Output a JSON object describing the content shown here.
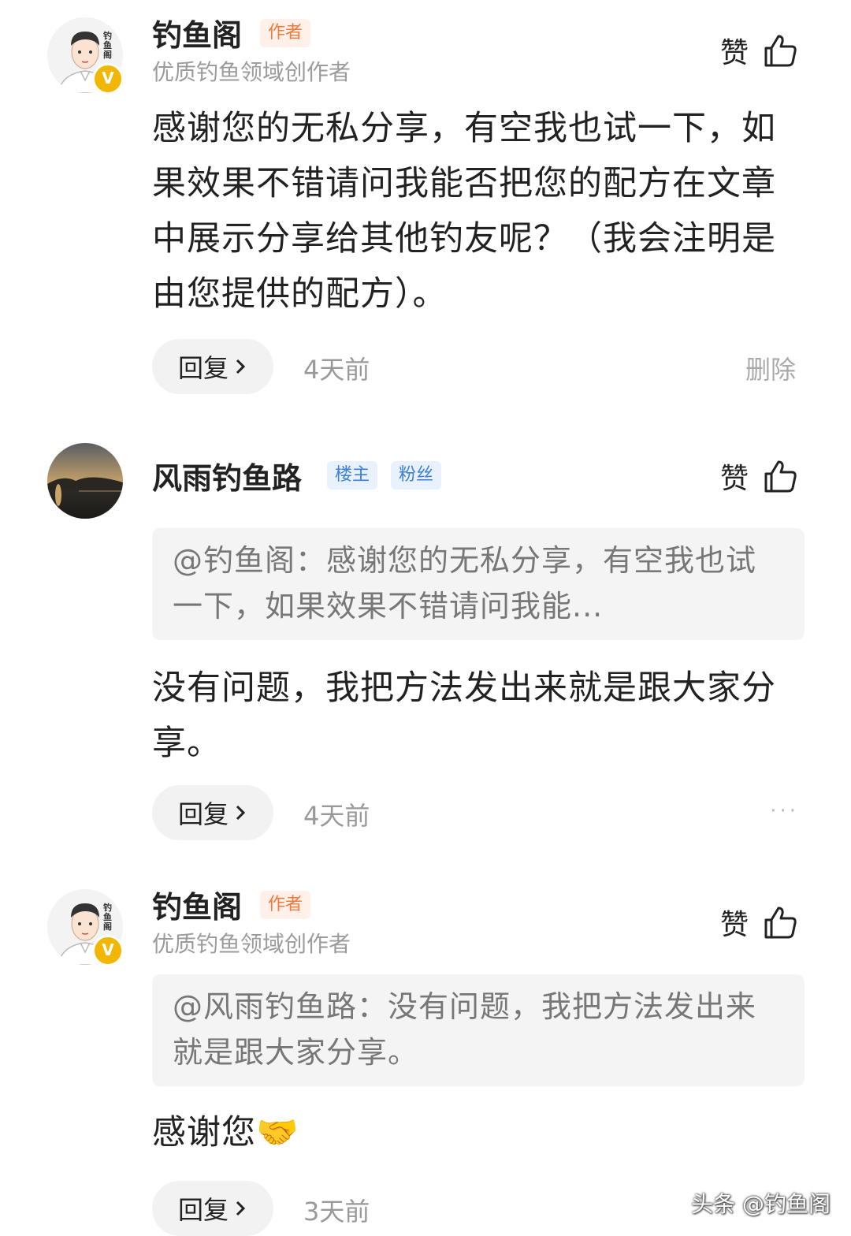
{
  "comments": [
    {
      "name": "钓鱼阁",
      "tag": "作者",
      "subtitle": "优质钓鱼领域创作者",
      "like_label": "赞",
      "text": "感谢您的无私分享，有空我也试一下，如果效果不错请问我能否把您的配方在文章中展示分享给其他钓友呢？（我会注明是由您提供的配方）。",
      "reply_label": "回复",
      "time": "4天前",
      "delete_label": "删除"
    },
    {
      "name": "风雨钓鱼路",
      "tags": [
        "楼主",
        "粉丝"
      ],
      "like_label": "赞",
      "quote": "@钓鱼阁：感谢您的无私分享，有空我也试一下，如果效果不错请问我能...",
      "text": "没有问题，我把方法发出来就是跟大家分享。",
      "reply_label": "回复",
      "time": "4天前",
      "more_label": "···"
    },
    {
      "name": "钓鱼阁",
      "tag": "作者",
      "subtitle": "优质钓鱼领域创作者",
      "like_label": "赞",
      "quote": "@风雨钓鱼路：没有问题，我把方法发出来就是跟大家分享。",
      "text": "感谢您",
      "emoji": "🤝",
      "reply_label": "回复",
      "time": "3天前"
    }
  ],
  "avatar_logo_text": "钓鱼阁",
  "verified_badge": "V",
  "watermark": "头条 @钓鱼阁",
  "icons": {
    "like": "thumbs-up-icon",
    "reply_arrow": "chevron-right-icon",
    "verified": "verified-badge-icon"
  },
  "colors": {
    "author_tag": "#f07a3a",
    "blue_tag": "#3d80d8",
    "verified": "#f2b705"
  }
}
